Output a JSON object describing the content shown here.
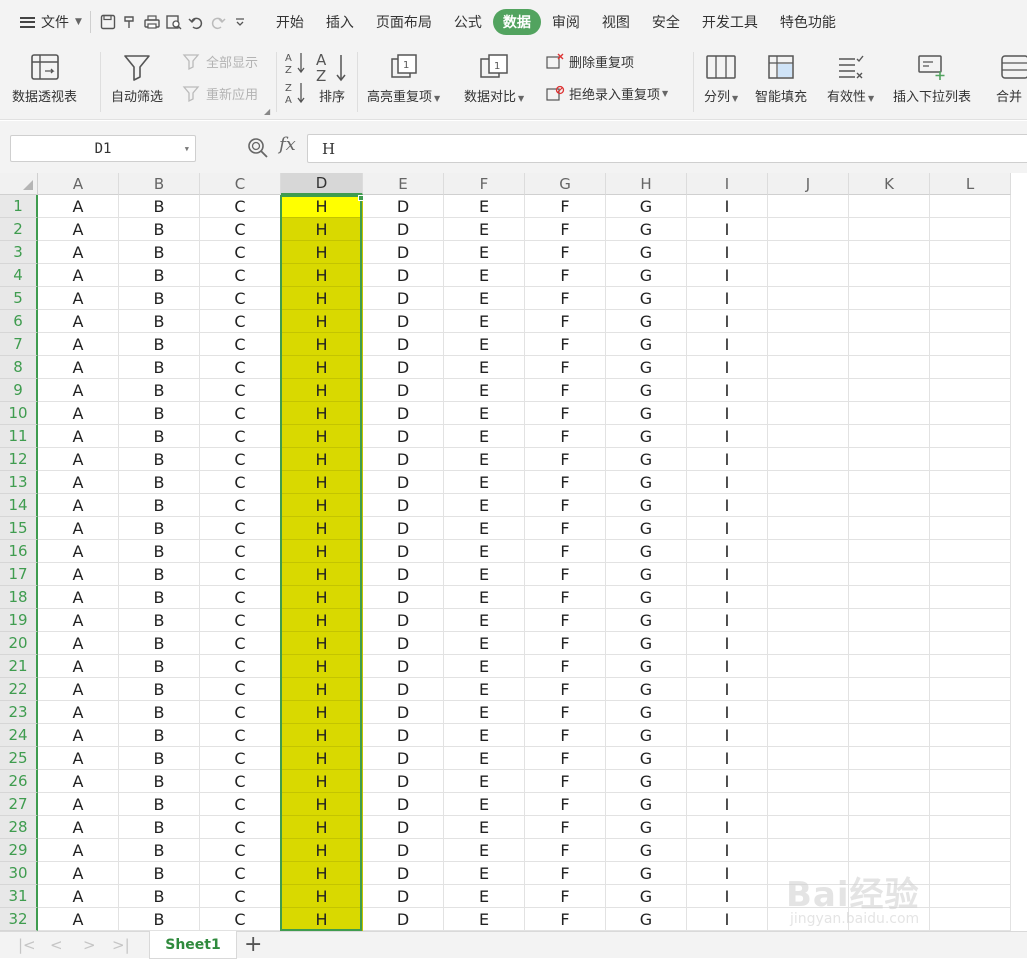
{
  "menubar": {
    "file_label": "文件",
    "tabs": [
      {
        "label": "开始",
        "active": false
      },
      {
        "label": "插入",
        "active": false
      },
      {
        "label": "页面布局",
        "active": false
      },
      {
        "label": "公式",
        "active": false
      },
      {
        "label": "数据",
        "active": true
      },
      {
        "label": "审阅",
        "active": false
      },
      {
        "label": "视图",
        "active": false
      },
      {
        "label": "安全",
        "active": false
      },
      {
        "label": "开发工具",
        "active": false
      },
      {
        "label": "特色功能",
        "active": false
      }
    ]
  },
  "ribbon": {
    "pivot": "数据透视表",
    "autofilter": "自动筛选",
    "show_all": "全部显示",
    "reapply": "重新应用",
    "sort": "排序",
    "highlight_dup": "高亮重复项",
    "compare": "数据对比",
    "remove_dup": "删除重复项",
    "reject_dup": "拒绝录入重复项",
    "split": "分列",
    "smart_fill": "智能填充",
    "validity": "有效性",
    "insert_dropdown": "插入下拉列表",
    "merge": "合并"
  },
  "formula_bar": {
    "name_box": "D1",
    "fx_label": "fx",
    "content": "H"
  },
  "grid": {
    "columns": [
      "A",
      "B",
      "C",
      "D",
      "E",
      "F",
      "G",
      "H",
      "I",
      "J",
      "K",
      "L"
    ],
    "selected_column": "D",
    "active_cell": "D1",
    "row_values": [
      "A",
      "B",
      "C",
      "H",
      "D",
      "E",
      "F",
      "G",
      "I",
      "",
      "",
      ""
    ],
    "rows": [
      "1",
      "2",
      "3",
      "4",
      "5",
      "6",
      "7",
      "8",
      "9",
      "10",
      "11",
      "12",
      "13",
      "14",
      "15",
      "16",
      "17",
      "18",
      "19",
      "20",
      "21",
      "22",
      "23",
      "24",
      "25",
      "26",
      "27",
      "28",
      "29",
      "30",
      "31",
      "32"
    ],
    "highlight_color": "#d9d900",
    "active_color": "#ffff00",
    "selection_color": "#3f9c4f"
  },
  "sheets": {
    "tabs": [
      "Sheet1"
    ],
    "active": "Sheet1",
    "add_label": "+"
  },
  "watermark": {
    "brand": "Bai经验",
    "url": "jingyan.baidu.com"
  }
}
